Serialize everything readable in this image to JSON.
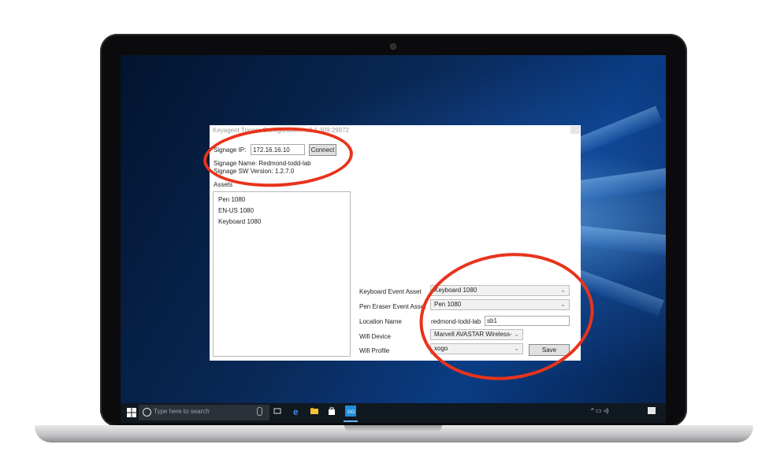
{
  "window": {
    "title": "Keyagent Trigger Configuration - v2.1.309.29972"
  },
  "connection": {
    "ip_label": "Signage IP:",
    "ip_value": "172.16.16.10",
    "connect_label": "Connect",
    "signage_name": "Signage Name: Redmond-todd-lab",
    "signage_sw_version": "Signage SW Version: 1.2.7.0"
  },
  "assets": {
    "header": "Assets",
    "items": [
      "Pen 1080",
      "EN-US 1080",
      "Keyboard 1080"
    ]
  },
  "settings": {
    "keyboard_label": "Keyboard Event Asset",
    "keyboard_value": "Keyboard 1080",
    "pen_label": "Pen Eraser Event Asset",
    "pen_value": "Pen 1080",
    "location_label": "Location Name",
    "location_prefix": "redmond-todd-lab",
    "location_value": "sb1",
    "wifi_device_label": "Wifi Device",
    "wifi_device_value": "Marvell AVASTAR Wireless-",
    "wifi_profile_label": "Wifi Profile",
    "wifi_profile_value": "xogo",
    "save_label": "Save"
  },
  "taskbar": {
    "search_placeholder": "Type here to search"
  },
  "colors": {
    "annotation": "#e8341c",
    "taskbar": "#101820",
    "desktop_accent": "#0a3c84"
  }
}
